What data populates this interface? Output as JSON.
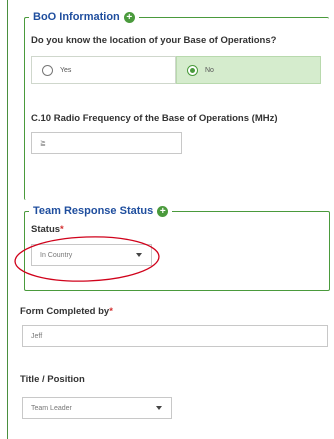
{
  "boo": {
    "legend": "BoO Information",
    "question": "Do you know the location of your Base of Operations?",
    "options": [
      {
        "label": "Yes",
        "selected": false
      },
      {
        "label": "No",
        "selected": true
      }
    ],
    "radio_freq_label": "C.10 Radio Frequency of the Base of Operations (MHz)",
    "radio_freq_value": "≧"
  },
  "team": {
    "legend": "Team Response Status",
    "status_label": "Status",
    "status_value": "In Country"
  },
  "form": {
    "completed_by_label": "Form Completed by",
    "completed_by_value": "Jeff",
    "title_label": "Title / Position",
    "title_value": "Team Leader"
  },
  "required_marker": "*",
  "colors": {
    "accent_green": "#4a9a3c",
    "legend_blue": "#1f4e9e",
    "selected_bg": "#d5eccd",
    "annotation_red": "#d0021b"
  }
}
